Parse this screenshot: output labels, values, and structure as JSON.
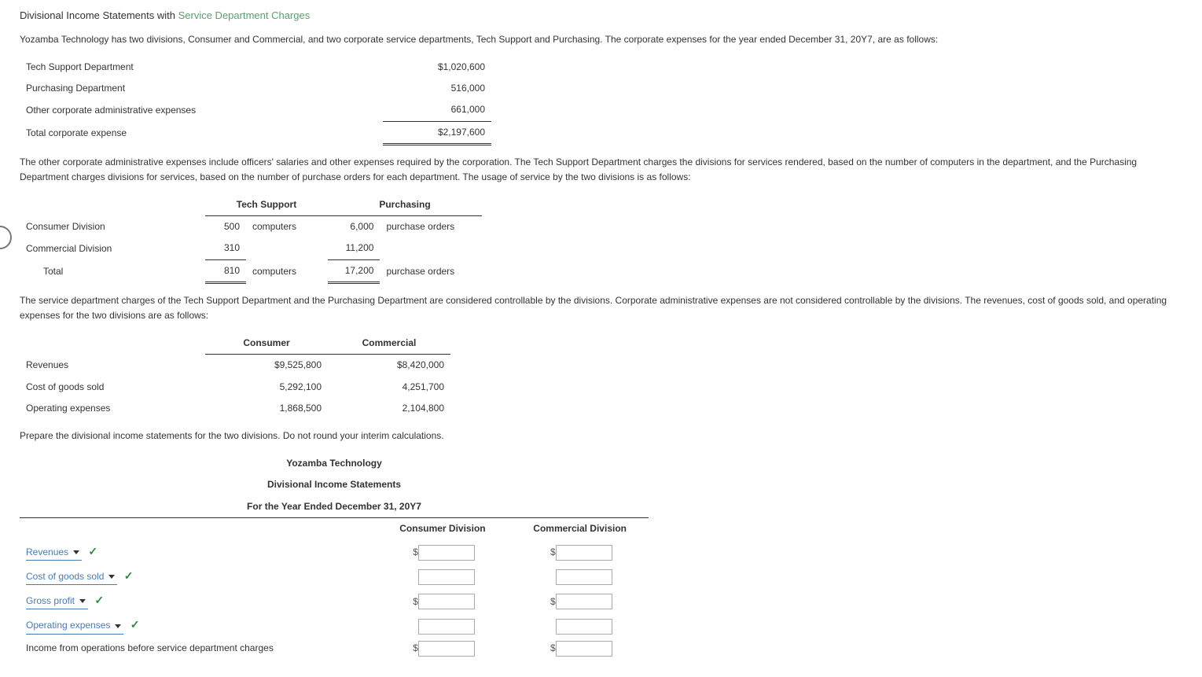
{
  "title": {
    "part1": "Divisional Income Statements with ",
    "highlight": "Service Department Charges"
  },
  "intro": "Yozamba Technology has two divisions, Consumer and Commercial, and two corporate service departments, Tech Support and Purchasing. The corporate expenses for the year ended December 31, 20Y7, are as follows:",
  "corp_expenses": {
    "rows": [
      {
        "label": "Tech Support Department",
        "value": "$1,020,600"
      },
      {
        "label": "Purchasing Department",
        "value": "516,000"
      },
      {
        "label": "Other corporate administrative expenses",
        "value": "661,000"
      }
    ],
    "total": {
      "label": "Total corporate expense",
      "value": "$2,197,600"
    }
  },
  "para2": "The other corporate administrative expenses include officers' salaries and other expenses required by the corporation. The Tech Support Department charges the divisions for services rendered, based on the number of computers in the department, and the Purchasing Department charges divisions for services, based on the number of purchase orders for each department. The usage of service by the two divisions is as follows:",
  "usage": {
    "headers": [
      "Tech Support",
      "Purchasing"
    ],
    "rows": [
      {
        "label": "Consumer Division",
        "c1": "500",
        "u1": "computers",
        "c2": "6,000",
        "u2": "purchase orders"
      },
      {
        "label": "Commercial Division",
        "c1": "310",
        "u1": "",
        "c2": "11,200",
        "u2": ""
      }
    ],
    "total": {
      "label": "Total",
      "c1": "810",
      "u1": "computers",
      "c2": "17,200",
      "u2": "purchase orders"
    }
  },
  "para3": "The service department charges of the Tech Support Department and the Purchasing Department are considered controllable by the divisions. Corporate administrative expenses are not considered controllable by the divisions. The revenues, cost of goods sold, and operating expenses for the two divisions are as follows:",
  "div_data": {
    "headers": [
      "Consumer",
      "Commercial"
    ],
    "rows": [
      {
        "label": "Revenues",
        "c1": "$9,525,800",
        "c2": "$8,420,000"
      },
      {
        "label": "Cost of goods sold",
        "c1": "5,292,100",
        "c2": "4,251,700"
      },
      {
        "label": "Operating expenses",
        "c1": "1,868,500",
        "c2": "2,104,800"
      }
    ]
  },
  "instruction": "Prepare the divisional income statements for the two divisions. Do not round your interim calculations.",
  "statement": {
    "company": "Yozamba Technology",
    "title": "Divisional Income Statements",
    "period": "For the Year Ended December 31, 20Y7",
    "col1": "Consumer Division",
    "col2": "Commercial Division",
    "lines": [
      {
        "dd": "Revenues",
        "dollar": true,
        "check": true
      },
      {
        "dd": "Cost of goods sold",
        "dollar": false,
        "check": true
      },
      {
        "dd": "Gross profit",
        "dollar": true,
        "check": true
      },
      {
        "dd": "Operating expenses",
        "dollar": false,
        "check": true
      }
    ],
    "static_line": {
      "label": "Income from operations before service department charges",
      "dollar": true
    }
  }
}
